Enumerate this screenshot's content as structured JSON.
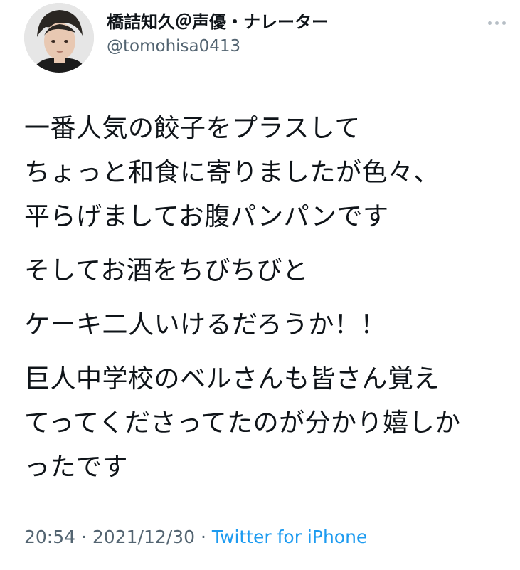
{
  "tweet": {
    "display_name": "橋詰知久＠声優・ナレーター",
    "handle": "@tomohisa0413",
    "paragraphs": [
      "一番人気の餃子をプラスして\nちょっと和食に寄りましたが色々、\n平らげましてお腹パンパンです",
      "そしてお酒をちびちびと",
      "ケーキ二人いけるだろうか！！",
      "巨人中学校のベルさんも皆さん覚え\nてってくださってたのが分かり嬉しか\nったです"
    ],
    "time": "20:54",
    "separator": "·",
    "date": "2021/12/30",
    "source": "Twitter for iPhone"
  },
  "icons": {
    "more": "more-horizontal-icon",
    "avatar": "profile-photo"
  },
  "colors": {
    "text": "#0f1419",
    "secondary": "#536471",
    "link": "#1d9bf0"
  }
}
